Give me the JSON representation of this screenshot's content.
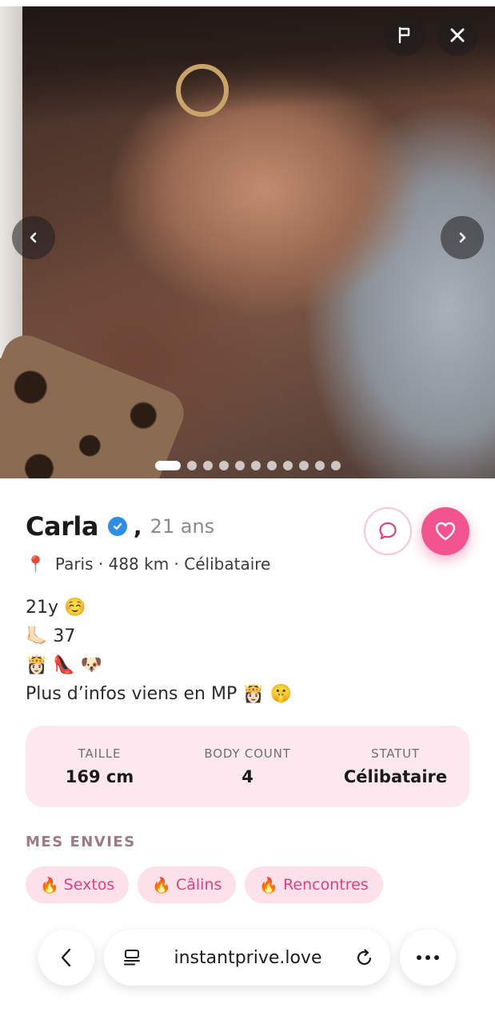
{
  "profile": {
    "name": "Carla",
    "comma": ",",
    "age": "21 ans",
    "location": "Paris · 488 km · Célibataire",
    "bio": [
      "21y ☺️",
      "🦶🏻 37",
      "👸🏻 👠 🐶",
      "Plus d’infos viens en MP 👸🏻 🤫"
    ]
  },
  "photos": {
    "count": 11,
    "active_index": 0
  },
  "stats": [
    {
      "label": "TAILLE",
      "value": "169 cm"
    },
    {
      "label": "BODY COUNT",
      "value": "4"
    },
    {
      "label": "STATUT",
      "value": "Célibataire"
    }
  ],
  "envies": {
    "title": "MES ENVIES",
    "items": [
      {
        "icon": "🔥",
        "label": "Sextos"
      },
      {
        "icon": "🔥",
        "label": "Câlins"
      },
      {
        "icon": "🔥",
        "label": "Rencontres"
      }
    ]
  },
  "browser": {
    "url": "instantprive.love"
  },
  "colors": {
    "accent": "#f2548f",
    "stats_bg": "#fde8ef",
    "chip_bg": "#fde1ea",
    "chip_text": "#e23f7c",
    "verified": "#2e8ee6"
  },
  "icons": {
    "flag": "flag-icon",
    "close": "close-icon",
    "prev": "chevron-left-icon",
    "next": "chevron-right-icon",
    "verified": "verified-badge-icon",
    "message": "chat-bubble-icon",
    "like": "heart-icon",
    "location": "pin-icon",
    "back": "back-arrow-icon",
    "tabs": "tabs-icon",
    "reload": "reload-icon",
    "more": "more-dots-icon"
  }
}
